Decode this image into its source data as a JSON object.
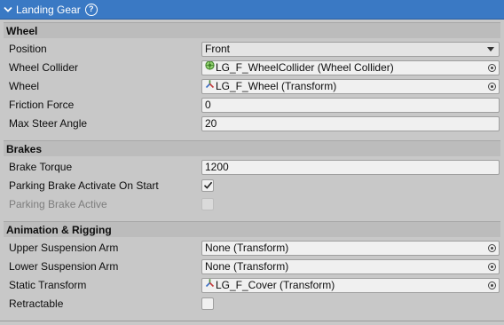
{
  "component": {
    "title": "Landing Gear"
  },
  "sections": {
    "wheel": {
      "header": "Wheel"
    },
    "brakes": {
      "header": "Brakes"
    },
    "animation": {
      "header": "Animation & Rigging"
    }
  },
  "fields": {
    "position": {
      "label": "Position",
      "value": "Front"
    },
    "wheel_collider": {
      "label": "Wheel Collider",
      "value": "LG_F_WheelCollider (Wheel Collider)",
      "icon": "wheel-collider-icon"
    },
    "wheel": {
      "label": "Wheel",
      "value": "LG_F_Wheel (Transform)",
      "icon": "transform-icon"
    },
    "friction_force": {
      "label": "Friction Force",
      "value": "0"
    },
    "max_steer_angle": {
      "label": "Max Steer Angle",
      "value": "20"
    },
    "brake_torque": {
      "label": "Brake Torque",
      "value": "1200"
    },
    "parking_brake_activate": {
      "label": "Parking Brake Activate On Start",
      "checked": true
    },
    "parking_brake_active": {
      "label": "Parking Brake Active",
      "checked": false,
      "disabled": true
    },
    "upper_suspension_arm": {
      "label": "Upper Suspension Arm",
      "value": "None (Transform)"
    },
    "lower_suspension_arm": {
      "label": "Lower Suspension Arm",
      "value": "None (Transform)"
    },
    "static_transform": {
      "label": "Static Transform",
      "value": "LG_F_Cover (Transform)",
      "icon": "transform-icon"
    },
    "retractable": {
      "label": "Retractable",
      "checked": false
    }
  },
  "colors": {
    "title_bar": "#3a79c4",
    "panel_bg": "#c8c8c8",
    "section_bg": "#bcbcbc",
    "field_bg": "#f0f0f0"
  }
}
